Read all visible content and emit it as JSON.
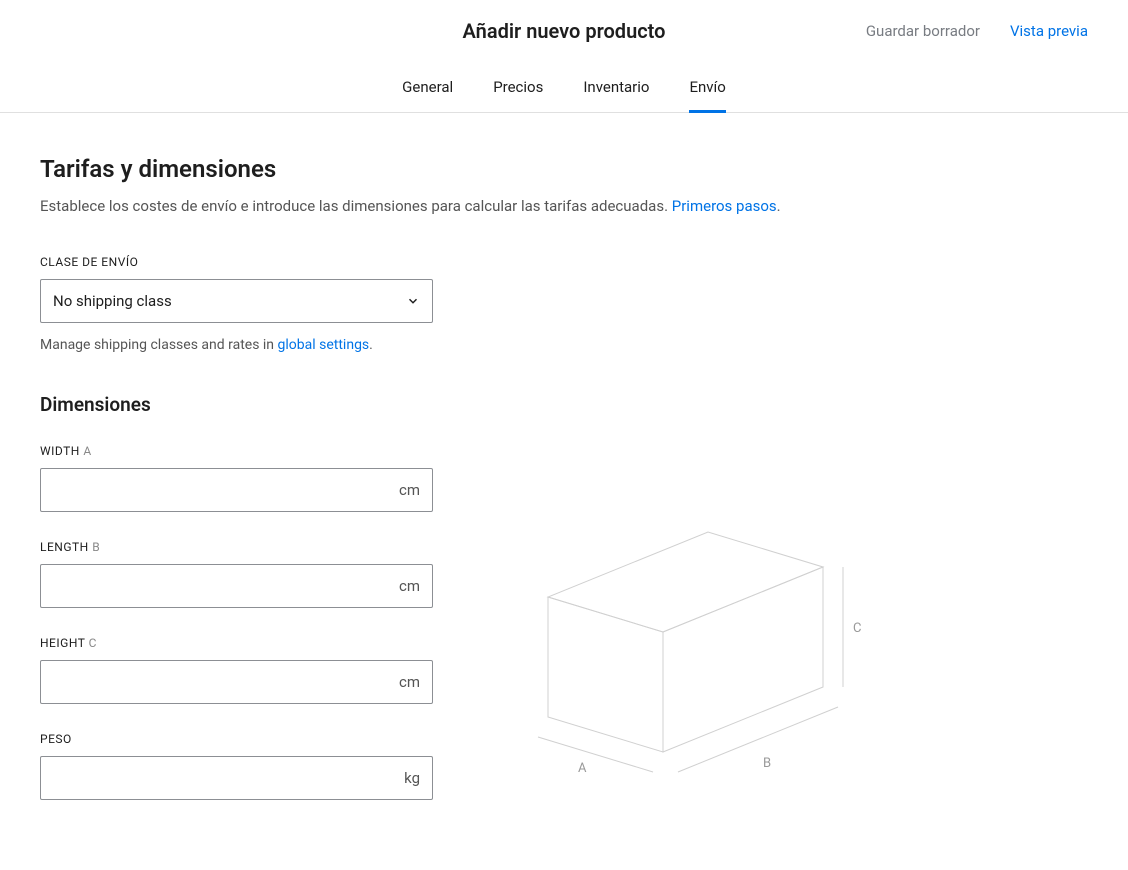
{
  "header": {
    "title": "Añadir nuevo producto",
    "save_draft": "Guardar borrador",
    "preview": "Vista previa"
  },
  "tabs": {
    "general": "General",
    "prices": "Precios",
    "inventory": "Inventario",
    "shipping": "Envío"
  },
  "section": {
    "title": "Tarifas y dimensiones",
    "desc_prefix": "Establece los costes de envío e introduce las dimensiones para calcular las tarifas adecuadas. ",
    "desc_link": "Primeros pasos",
    "desc_period": "."
  },
  "shipping_class": {
    "label": "CLASE DE ENVÍO",
    "value": "No shipping class",
    "helper_prefix": "Manage shipping classes and rates in ",
    "helper_link": "global settings",
    "helper_period": "."
  },
  "dimensions": {
    "title": "Dimensiones",
    "width_label": "WIDTH ",
    "width_suffix": "A",
    "length_label": "LENGTH ",
    "length_suffix": "B",
    "height_label": "HEIGHT ",
    "height_suffix": "C",
    "weight_label": "PESO",
    "unit_cm": "cm",
    "unit_kg": "kg"
  },
  "diagram": {
    "label_a": "A",
    "label_b": "B",
    "label_c": "C"
  }
}
